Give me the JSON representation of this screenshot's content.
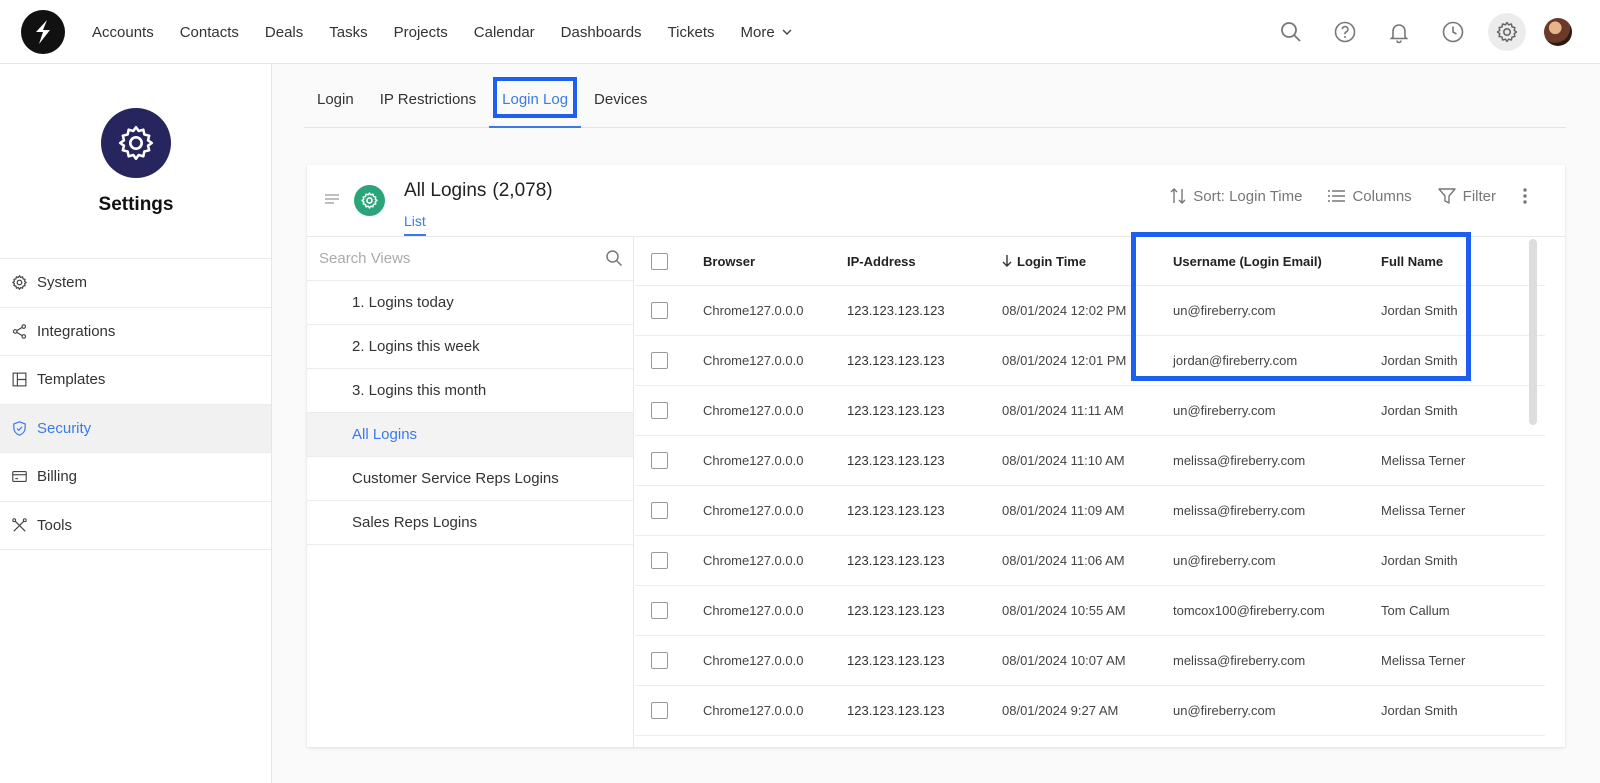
{
  "nav": {
    "items": [
      "Accounts",
      "Contacts",
      "Deals",
      "Tasks",
      "Projects",
      "Calendar",
      "Dashboards",
      "Tickets",
      "More"
    ]
  },
  "top_icons": [
    "search-icon",
    "help-icon",
    "bell-icon",
    "clock-icon",
    "gear-icon",
    "avatar"
  ],
  "sidebar": {
    "title": "Settings",
    "items": [
      {
        "label": "System",
        "icon": "gear-icon"
      },
      {
        "label": "Integrations",
        "icon": "share-icon"
      },
      {
        "label": "Templates",
        "icon": "layout-icon"
      },
      {
        "label": "Security",
        "icon": "shield-icon",
        "active": true
      },
      {
        "label": "Billing",
        "icon": "card-icon"
      },
      {
        "label": "Tools",
        "icon": "tools-icon"
      }
    ]
  },
  "tabs": [
    {
      "label": "Login"
    },
    {
      "label": "IP Restrictions"
    },
    {
      "label": "Login Log",
      "active": true
    },
    {
      "label": "Devices"
    }
  ],
  "view": {
    "title": "All Logins",
    "count": "(2,078)",
    "list_tab": "List"
  },
  "toolbar": {
    "sort": "Sort: Login Time",
    "columns": "Columns",
    "filter": "Filter"
  },
  "views": {
    "search_placeholder": "Search Views",
    "items": [
      {
        "label": "1. Logins today"
      },
      {
        "label": "2. Logins this week"
      },
      {
        "label": "3. Logins this month"
      },
      {
        "label": "All Logins",
        "active": true
      },
      {
        "label": "Customer Service Reps Logins"
      },
      {
        "label": "Sales Reps Logins"
      }
    ]
  },
  "table": {
    "columns": [
      "Browser",
      "IP-Address",
      "Login Time",
      "Username (Login Email)",
      "Full Name"
    ],
    "rows": [
      [
        "Chrome127.0.0.0",
        "123.123.123.123",
        "08/01/2024 12:02 PM",
        "un@fireberry.com",
        "Jordan Smith"
      ],
      [
        "Chrome127.0.0.0",
        "123.123.123.123",
        "08/01/2024 12:01 PM",
        "jordan@fireberry.com",
        "Jordan Smith"
      ],
      [
        "Chrome127.0.0.0",
        "123.123.123.123",
        "08/01/2024 11:11 AM",
        "un@fireberry.com",
        "Jordan Smith"
      ],
      [
        "Chrome127.0.0.0",
        "123.123.123.123",
        "08/01/2024 11:10 AM",
        "melissa@fireberry.com",
        "Melissa Terner"
      ],
      [
        "Chrome127.0.0.0",
        "123.123.123.123",
        "08/01/2024 11:09 AM",
        "melissa@fireberry.com",
        "Melissa Terner"
      ],
      [
        "Chrome127.0.0.0",
        "123.123.123.123",
        "08/01/2024 11:06 AM",
        "un@fireberry.com",
        "Jordan Smith"
      ],
      [
        "Chrome127.0.0.0",
        "123.123.123.123",
        "08/01/2024 10:55 AM",
        "tomcox100@fireberry.com",
        "Tom Callum"
      ],
      [
        "Chrome127.0.0.0",
        "123.123.123.123",
        "08/01/2024 10:07 AM",
        "melissa@fireberry.com",
        "Melissa Terner"
      ],
      [
        "Chrome127.0.0.0",
        "123.123.123.123",
        "08/01/2024 9:27 AM",
        "un@fireberry.com",
        "Jordan Smith"
      ]
    ]
  },
  "colors": {
    "accent": "#3a7be8",
    "highlight": "#1f5ff0",
    "settings_badge": "#26255e",
    "view_badge": "#2aa57a"
  }
}
